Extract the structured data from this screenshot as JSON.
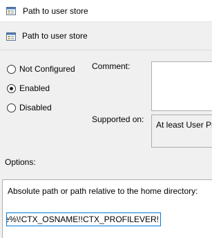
{
  "window": {
    "title": "Path to user store"
  },
  "header": {
    "setting_name": "Path to user store"
  },
  "state": {
    "options": [
      {
        "label": "Not Configured",
        "selected": false
      },
      {
        "label": "Enabled",
        "selected": true
      },
      {
        "label": "Disabled",
        "selected": false
      }
    ]
  },
  "comment": {
    "label": "Comment:",
    "value": ""
  },
  "supported": {
    "label": "Supported on:",
    "value": "At least User Pro"
  },
  "options": {
    "label": "Options:",
    "description": "Absolute path or path relative to the home directory:",
    "path_value": "ame%\\!CTX_OSNAME!!CTX_PROFILEVER!"
  },
  "colors": {
    "focus_border": "#0078d7",
    "window_bg": "#f0f0f0"
  },
  "icons": {
    "title": "policy-setting-icon",
    "header": "policy-setting-icon"
  }
}
